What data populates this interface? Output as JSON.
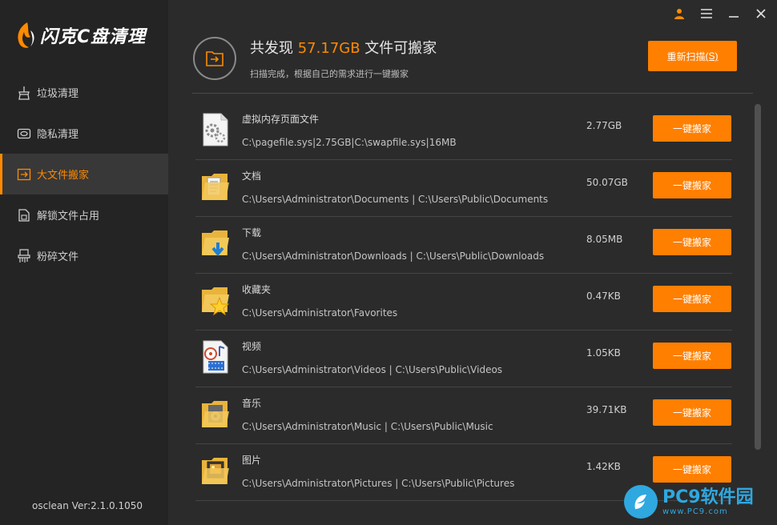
{
  "app": {
    "logo_text": "闪克C盘清理",
    "version": "osclean Ver:2.1.0.1050"
  },
  "window_controls": {
    "user_icon": "user-icon",
    "menu_icon": "menu-icon",
    "minimize_icon": "minimize-icon",
    "close_icon": "close-icon"
  },
  "sidebar": {
    "items": [
      {
        "label": "垃圾清理",
        "icon": "broom-icon",
        "active": false
      },
      {
        "label": "隐私清理",
        "icon": "privacy-icon",
        "active": false
      },
      {
        "label": "大文件搬家",
        "icon": "move-file-icon",
        "active": true
      },
      {
        "label": "解锁文件占用",
        "icon": "unlock-icon",
        "active": false
      },
      {
        "label": "粉碎文件",
        "icon": "shredder-icon",
        "active": false
      }
    ]
  },
  "header": {
    "title_prefix": "共发现 ",
    "title_size": "57.17GB",
    "title_suffix": " 文件可搬家",
    "subtitle": "扫描完成，根据自己的需求进行一键搬家",
    "rescan_label": "重新扫描",
    "rescan_shortcut": "(S)"
  },
  "list": {
    "button_label": "一键搬家",
    "rows": [
      {
        "name": "虚拟内存页面文件",
        "path": "C:\\pagefile.sys|2.75GB|C:\\swapfile.sys|16MB",
        "size": "2.77GB",
        "icon": "gear-file-icon"
      },
      {
        "name": "文档",
        "path": "C:\\Users\\Administrator\\Documents | C:\\Users\\Public\\Documents",
        "size": "50.07GB",
        "icon": "documents-folder-icon"
      },
      {
        "name": "下载",
        "path": "C:\\Users\\Administrator\\Downloads | C:\\Users\\Public\\Downloads",
        "size": "8.05MB",
        "icon": "downloads-folder-icon"
      },
      {
        "name": "收藏夹",
        "path": "C:\\Users\\Administrator\\Favorites",
        "size": "0.47KB",
        "icon": "favorites-folder-icon"
      },
      {
        "name": "视频",
        "path": "C:\\Users\\Administrator\\Videos | C:\\Users\\Public\\Videos",
        "size": "1.05KB",
        "icon": "videos-file-icon"
      },
      {
        "name": "音乐",
        "path": "C:\\Users\\Administrator\\Music | C:\\Users\\Public\\Music",
        "size": "39.71KB",
        "icon": "music-folder-icon"
      },
      {
        "name": "图片",
        "path": "C:\\Users\\Administrator\\Pictures | C:\\Users\\Public\\Pictures",
        "size": "1.42KB",
        "icon": "pictures-folder-icon"
      }
    ]
  },
  "watermark": {
    "main": "PC9软件园",
    "sub": "www.PC9.com"
  },
  "colors": {
    "accent": "#ff7f00",
    "sidebar_bg": "#242424",
    "main_bg": "#2b2b2b"
  }
}
